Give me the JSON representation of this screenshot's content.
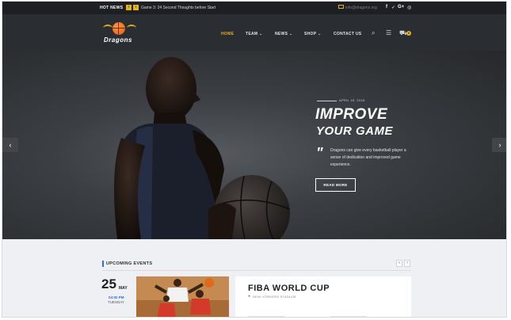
{
  "topbar": {
    "hot_news_label": "HOT NEWS",
    "prev_icon": "chevron-left-icon",
    "next_icon": "chevron-right-icon",
    "headline": "Game 3: 24 Second Thoughts before Start",
    "email": "info@dragons.org",
    "social": [
      "facebook-icon",
      "twitter-icon",
      "google-plus-icon",
      "instagram-icon"
    ]
  },
  "header": {
    "logo_text": "Dragons",
    "nav": [
      {
        "label": "HOME",
        "active": true
      },
      {
        "label": "TEAM ⌄",
        "active": false
      },
      {
        "label": "NEWS ⌄",
        "active": false
      },
      {
        "label": "SHOP ⌄",
        "active": false
      },
      {
        "label": "CONTACT US",
        "active": false
      }
    ],
    "cart_count": "0",
    "accent_color": "#e8b21f"
  },
  "hero": {
    "date": "APRIL 15, 2018",
    "title_line1": "IMPROVE",
    "title_line2": "YOUR GAME",
    "description": "Dragons can give every basketball player a sense of dedication and improved game experience.",
    "button_label": "READ MORE",
    "prev_arrow": "‹",
    "next_arrow": "›"
  },
  "events": {
    "section_title": "UPCOMING EVENTS",
    "prev": "‹",
    "next": "›",
    "day": "25",
    "month": "MAY",
    "time": "04:00 PM",
    "weekday": "TUESDAY",
    "title": "FIBA WORLD CUP",
    "venue": "NEW YORKERS STADIUM",
    "accent_color": "#2c6be0"
  }
}
